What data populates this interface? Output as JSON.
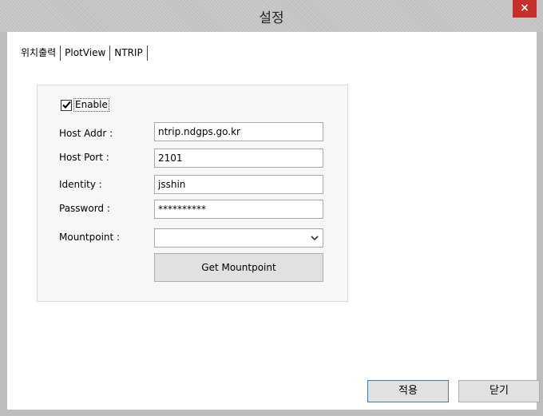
{
  "window": {
    "title": "설정",
    "close_glyph": "×"
  },
  "tabs": [
    {
      "label": "위치출력"
    },
    {
      "label": "PlotView"
    },
    {
      "label": "NTRIP"
    }
  ],
  "form": {
    "enable_label": "Enable",
    "enable_checked": true,
    "host_addr_label": "Host Addr :",
    "host_addr_value": "ntrip.ndgps.go.kr",
    "host_port_label": "Host Port :",
    "host_port_value": "2101",
    "identity_label": "Identity :",
    "identity_value": "jsshin",
    "password_label": "Password :",
    "password_value": "**********",
    "mountpoint_label": "Mountpoint :",
    "mountpoint_value": "",
    "get_mountpoint_label": "Get Mountpoint"
  },
  "footer": {
    "apply_label": "적용",
    "close_label": "닫기"
  },
  "colors": {
    "close_button": "#c7302a",
    "titlebar": "#c9c9c9",
    "default_button_border": "#3c7fb1"
  }
}
